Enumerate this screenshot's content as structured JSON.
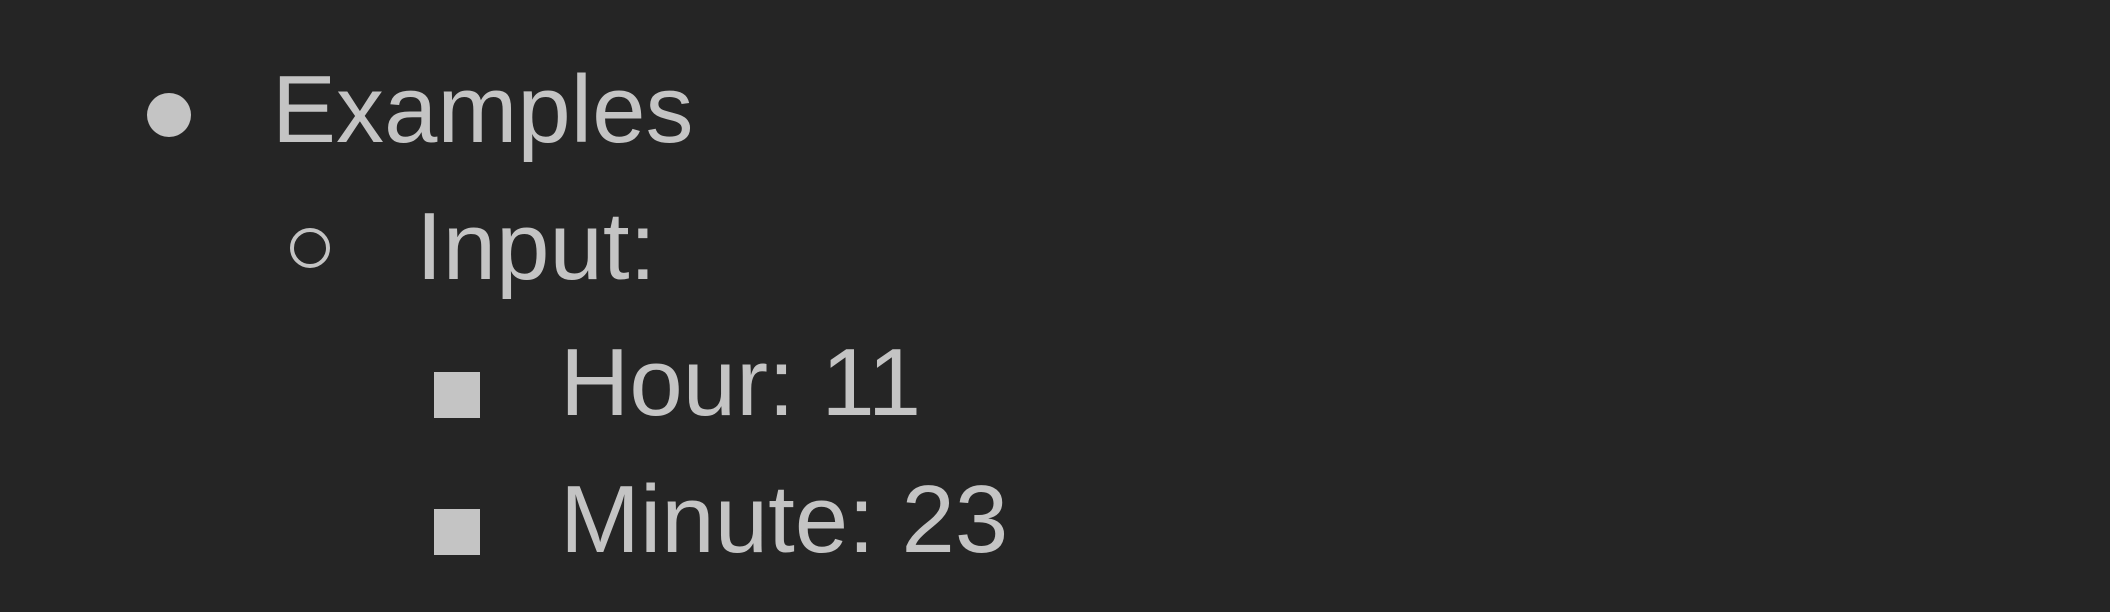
{
  "outline": {
    "level1": {
      "label": "Examples",
      "bullet_icon": "filled-circle-bullet"
    },
    "level2": {
      "label": "Input:",
      "bullet_icon": "hollow-circle-bullet"
    },
    "level3": [
      {
        "label": "Hour: 11",
        "bullet_icon": "filled-square-bullet"
      },
      {
        "label": "Minute: 23",
        "bullet_icon": "filled-square-bullet"
      }
    ]
  },
  "colors": {
    "background": "#252525",
    "text": "#c4c4c4"
  }
}
